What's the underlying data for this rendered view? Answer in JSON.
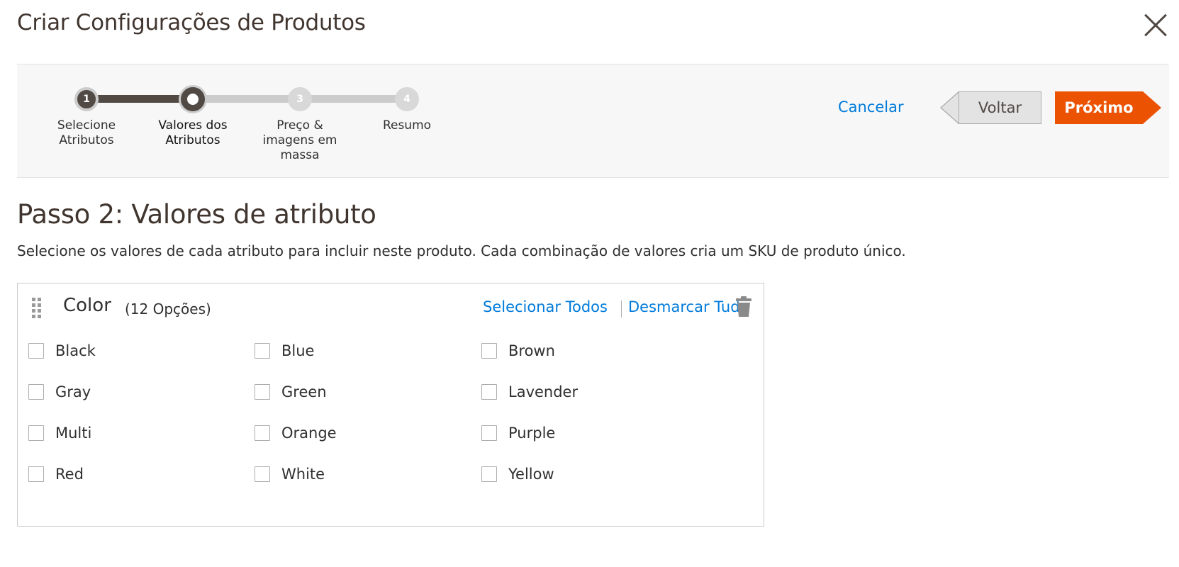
{
  "modal": {
    "title": "Criar Configurações de Produtos"
  },
  "wizard": {
    "steps": [
      {
        "number": "1",
        "label": "Selecione\nAtributos",
        "state": "done"
      },
      {
        "number": "",
        "label": "Valores dos\nAtributos",
        "state": "current"
      },
      {
        "number": "3",
        "label": "Preço &\nimagens em\nmassa",
        "state": "todo"
      },
      {
        "number": "4",
        "label": "Resumo",
        "state": "todo"
      }
    ],
    "cancel_label": "Cancelar",
    "back_label": "Voltar",
    "next_label": "Próximo"
  },
  "content": {
    "heading": "Passo 2: Valores de atributo",
    "description": "Selecione os valores de cada atributo para incluir neste produto. Cada combinação de valores cria um SKU de produto único."
  },
  "attribute": {
    "name": "Color",
    "count": "(12 Opções)",
    "select_all": "Selecionar Todos",
    "deselect_all": "Desmarcar Tudo",
    "options": [
      {
        "label": "Black",
        "checked": false
      },
      {
        "label": "Blue",
        "checked": false
      },
      {
        "label": "Brown",
        "checked": false
      },
      {
        "label": "Gray",
        "checked": false
      },
      {
        "label": "Green",
        "checked": false
      },
      {
        "label": "Lavender",
        "checked": false
      },
      {
        "label": "Multi",
        "checked": false
      },
      {
        "label": "Orange",
        "checked": false
      },
      {
        "label": "Purple",
        "checked": false
      },
      {
        "label": "Red",
        "checked": false
      },
      {
        "label": "White",
        "checked": false
      },
      {
        "label": "Yellow",
        "checked": false
      }
    ]
  },
  "colors": {
    "accent": "#eb5202",
    "link": "#007bdb",
    "progress_done": "#514943",
    "progress_todo": "#cccccc"
  },
  "icons": [
    "close-icon",
    "drag-handle-icon",
    "trash-icon",
    "back-arrow-icon",
    "next-arrow-icon"
  ]
}
